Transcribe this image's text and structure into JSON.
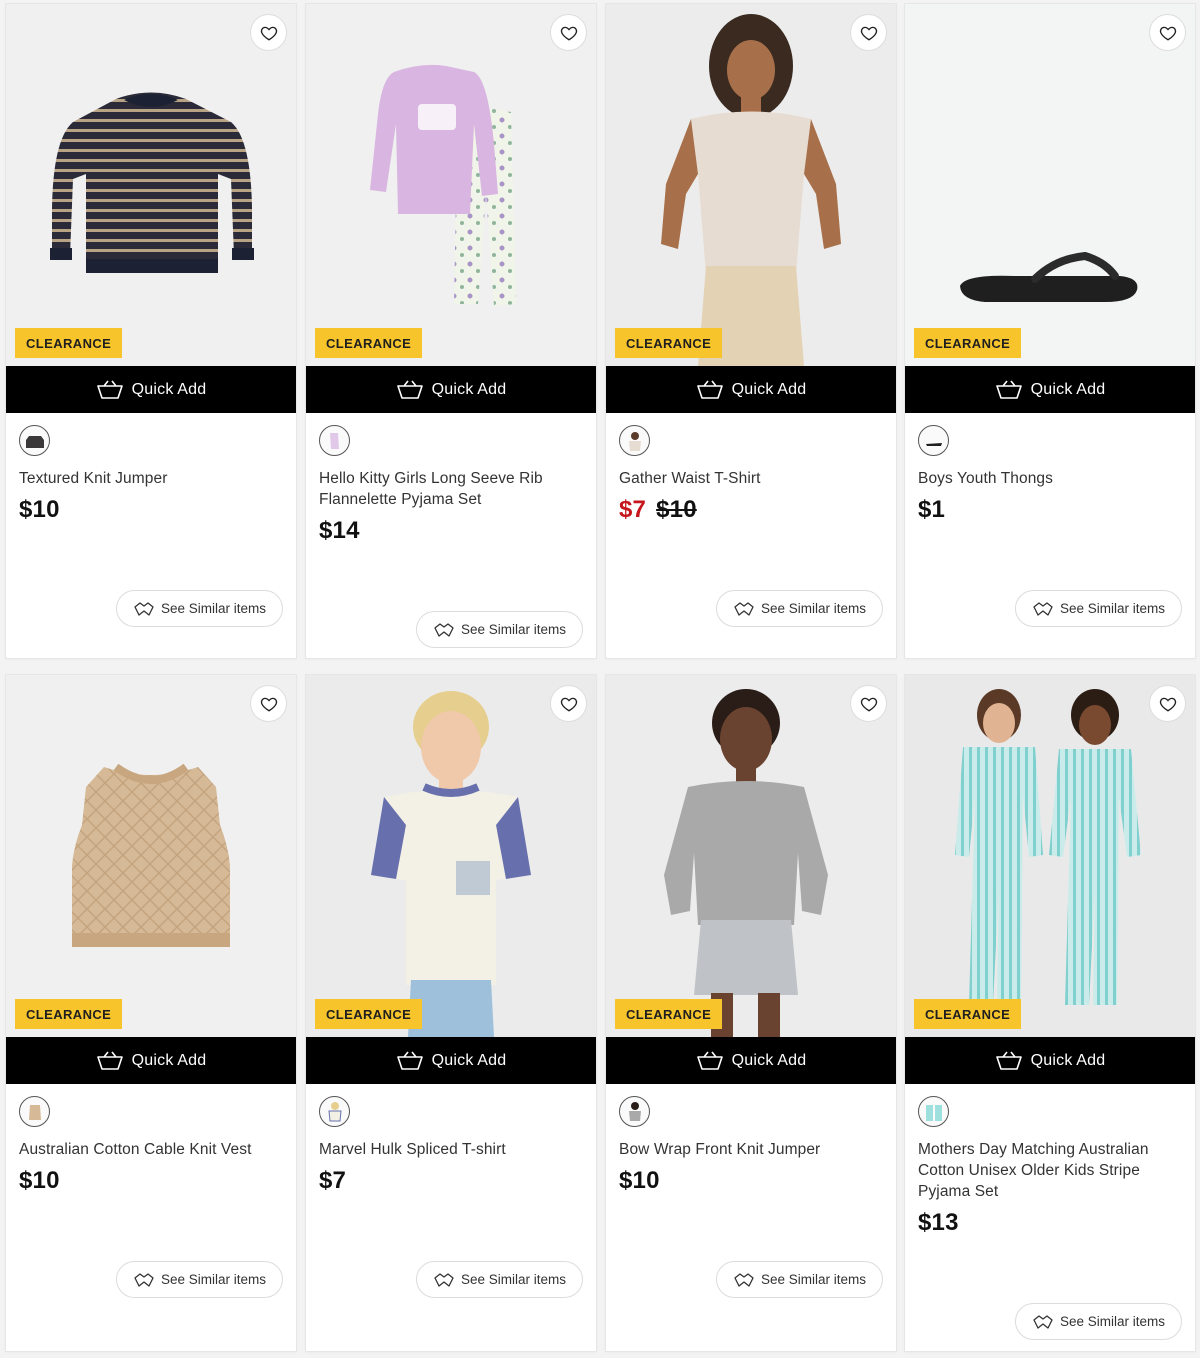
{
  "products": [
    {
      "title": "Textured Knit Jumper",
      "price": "$10",
      "badge": "CLEARANCE",
      "quick_add": "Quick Add",
      "similar": "See Similar items",
      "favorite_icon": "heart-outline-icon",
      "image": "navy-tan-striped-knit-jumper"
    },
    {
      "title": "Hello Kitty Girls Long Seeve Rib Flannelette Pyjama Set",
      "price": "$14",
      "badge": "CLEARANCE",
      "quick_add": "Quick Add",
      "similar": "See Similar items",
      "favorite_icon": "heart-outline-icon",
      "image": "lilac-top-floral-pants-pyjama"
    },
    {
      "title": "Gather Waist T-Shirt",
      "price": "$7",
      "was_price": "$10",
      "badge": "CLEARANCE",
      "quick_add": "Quick Add",
      "similar": "See Similar items",
      "favorite_icon": "heart-outline-icon",
      "image": "model-beige-tshirt",
      "sale_color": "#c4161c"
    },
    {
      "title": "Boys Youth Thongs",
      "price": "$1",
      "badge": "CLEARANCE",
      "quick_add": "Quick Add",
      "similar": "See Similar items",
      "favorite_icon": "heart-outline-icon",
      "image": "black-thong-sandal"
    },
    {
      "title": "Australian Cotton Cable Knit Vest",
      "price": "$10",
      "badge": "CLEARANCE",
      "quick_add": "Quick Add",
      "similar": "See Similar items",
      "favorite_icon": "heart-outline-icon",
      "image": "beige-cable-knit-vest"
    },
    {
      "title": "Marvel Hulk Spliced T-shirt",
      "price": "$7",
      "badge": "CLEARANCE",
      "quick_add": "Quick Add",
      "similar": "See Similar items",
      "favorite_icon": "heart-outline-icon",
      "image": "boy-white-purple-tshirt"
    },
    {
      "title": "Bow Wrap Front Knit Jumper",
      "price": "$10",
      "badge": "CLEARANCE",
      "quick_add": "Quick Add",
      "similar": "See Similar items",
      "favorite_icon": "heart-outline-icon",
      "image": "girl-grey-knit-jumper"
    },
    {
      "title": "Mothers Day Matching Australian Cotton Unisex Older Kids Stripe Pyjama Set",
      "price": "$13",
      "badge": "CLEARANCE",
      "quick_add": "Quick Add",
      "similar": "See Similar items",
      "favorite_icon": "heart-outline-icon",
      "image": "kids-mint-stripe-pyjamas"
    }
  ],
  "colors": {
    "badge": "#f7c52b",
    "quick_add_bg": "#000000",
    "sale": "#c4161c"
  }
}
